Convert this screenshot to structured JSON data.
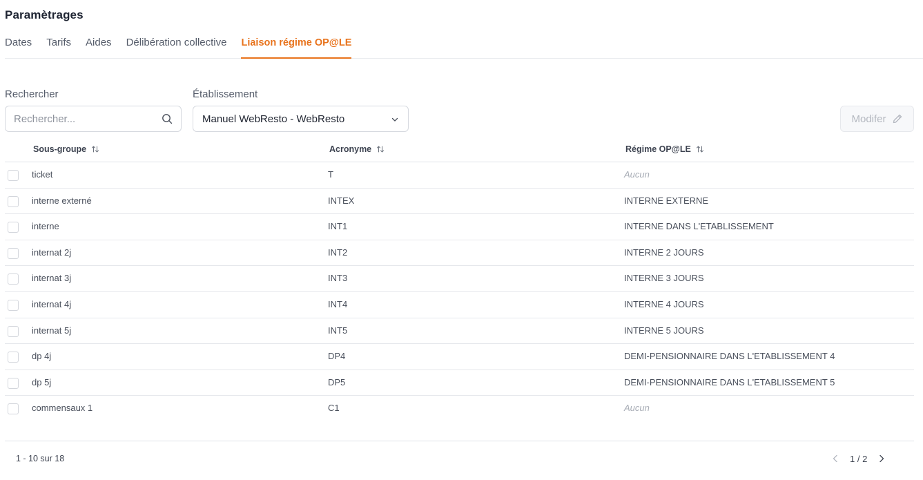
{
  "page": {
    "title": "Paramètrages"
  },
  "tabs": [
    {
      "label": "Dates"
    },
    {
      "label": "Tarifs"
    },
    {
      "label": "Aides"
    },
    {
      "label": "Délibération collective"
    },
    {
      "label": "Liaison régime OP@LE",
      "active": true
    }
  ],
  "filters": {
    "search_label": "Rechercher",
    "search_placeholder": "Rechercher...",
    "search_value": "",
    "establishment_label": "Établissement",
    "establishment_value": "Manuel WebResto - WebResto"
  },
  "toolbar": {
    "modify_label": "Modifer"
  },
  "table": {
    "columns": [
      "Sous-groupe",
      "Acronyme",
      "Régime OP@LE"
    ],
    "rows": [
      {
        "subgroup": "ticket",
        "acronym": "T",
        "regime": "Aucun",
        "none": true
      },
      {
        "subgroup": "interne externé",
        "acronym": "INTEX",
        "regime": "INTERNE EXTERNE"
      },
      {
        "subgroup": "interne",
        "acronym": "INT1",
        "regime": "INTERNE DANS L'ETABLISSEMENT"
      },
      {
        "subgroup": "internat 2j",
        "acronym": "INT2",
        "regime": "INTERNE 2 JOURS"
      },
      {
        "subgroup": "internat 3j",
        "acronym": "INT3",
        "regime": "INTERNE 3 JOURS"
      },
      {
        "subgroup": "internat 4j",
        "acronym": "INT4",
        "regime": "INTERNE 4 JOURS"
      },
      {
        "subgroup": "internat 5j",
        "acronym": "INT5",
        "regime": "INTERNE 5 JOURS"
      },
      {
        "subgroup": "dp 4j",
        "acronym": "DP4",
        "regime": "DEMI-PENSIONNAIRE DANS L'ETABLISSEMENT 4"
      },
      {
        "subgroup": "dp 5j",
        "acronym": "DP5",
        "regime": "DEMI-PENSIONNAIRE DANS L'ETABLISSEMENT 5"
      },
      {
        "subgroup": "commensaux 1",
        "acronym": "C1",
        "regime": "Aucun",
        "none": true
      }
    ]
  },
  "pagination": {
    "range": "1 - 10 sur 18",
    "page": "1 / 2"
  },
  "colors": {
    "accent": "#e8731c",
    "border": "#d6d9df",
    "muted": "#a8adb6"
  },
  "icons": {
    "search": "search-icon",
    "select": "chevron-down-icon",
    "modify": "pencil-icon",
    "sort": "sort-arrows-icon",
    "prev": "chevron-left-icon",
    "next": "chevron-right-icon"
  }
}
